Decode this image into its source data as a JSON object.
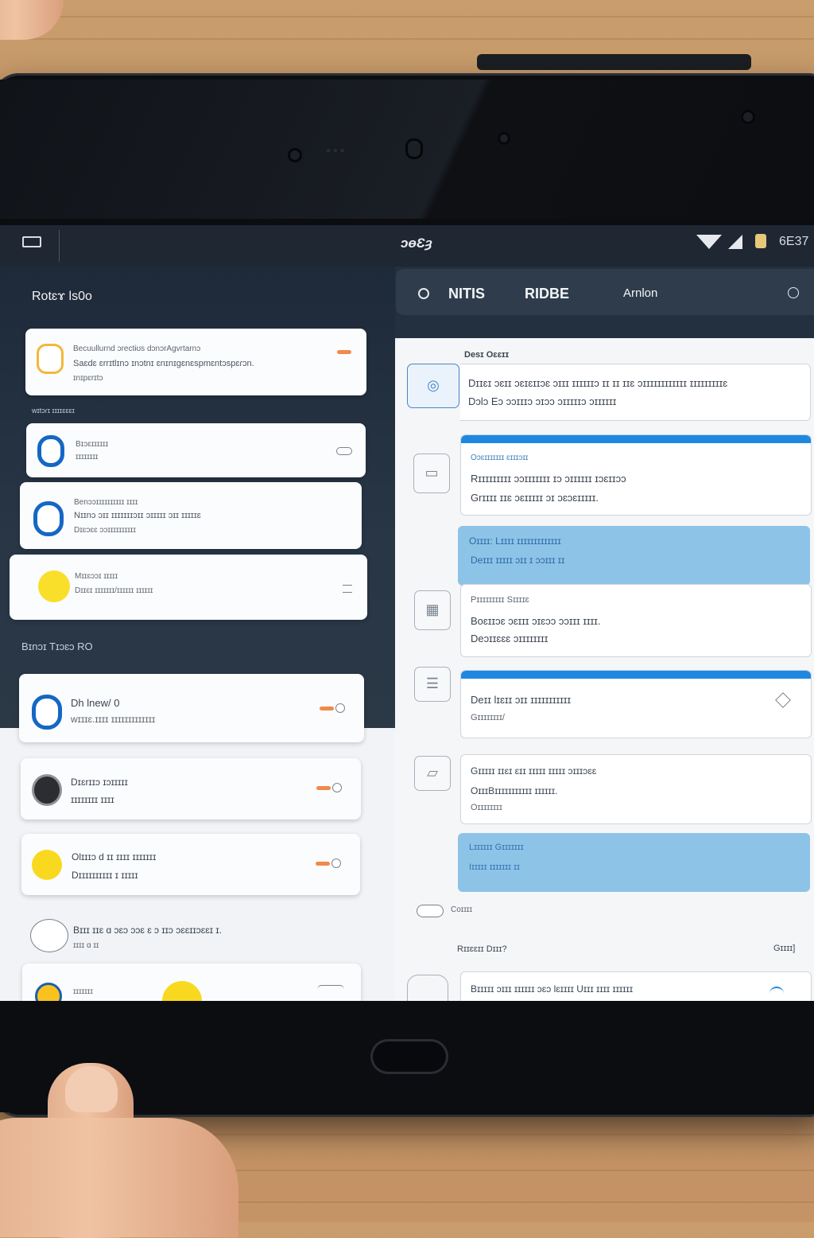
{
  "status_bar": {
    "time": "ɔɵƐȝ",
    "battery_text": "6E37"
  },
  "left_sidebar": {
    "title": "Rotɛɤ ls0o",
    "notification_top": {
      "line1": "Becuullurnd ɔrectɨʊs dɔnɔrAgvrtarnɔ",
      "line2": "Saɛdɛ ɛrrɪtlɪnɔ ɪnɔtnɪ ɛnɪnɪgɛnɛspmɛntɔspɛɾɔn.",
      "line3": "ɪnɪpɛrɪtɔ"
    },
    "section1_label": "wɪtɔɾɪ ɪɪɪɪɛɛɛɪ",
    "items_a": [
      {
        "line1": "Bɪɔɛɪɪɪɪɪɪ",
        "line2": "ɪɪɪɪɪɪɪɪ"
      },
      {
        "line1": "Benɔɔɪɪɪɪɪɪɪɪɪɪ ɪɪɪɪ",
        "line2": "Nɪɪnɔ ɔɪɪ ɪɪɪɪɪɪɪɔɪɪ ɔɪɪɪɪɪ ɔɪɪ ɪɪɪɪɪɛ",
        "line3": "Dɪɛɔɛɛ ɔɔɪɪɪɪɪɪɪɪɪɪ"
      },
      {
        "line1": "Mɪɪɛɔɔɪ ɪɪɪɪɪ",
        "line2": "Dɪɪɛɪ ɪɪɪɪɪɪɪ/ɪɪɪɪɪɪ ɪɪɪɪɪɪ"
      }
    ],
    "section2_label": "Bɪnɔɪ Tɪɔɛɔ RO",
    "items_b": [
      {
        "line1": "Dh lnew/ 0",
        "line2": "wɪɪɪɛ.ɪɪɪɪ ɪɪɪɪɪɪɪɪɪɪɪɪɪ"
      },
      {
        "line1": "Dɪɛrɪɪɔ ɪɔɪɪɪɪɪ",
        "line2": "ɪɪɪɪɪɪɪɪ ɪɪɪɪ"
      },
      {
        "line1": "Olɪɪɪɔ d ɪɪ ɪɪɪɪ ɪɪɪɪɪɪɪ",
        "line2": "Dɪɪɪɪɪɪɪɪɪɪ ɪ ɪɪɪɪɪ"
      }
    ],
    "footer_line1": "Bɪɪɪ ɪɪɛ ɑ ɔɛɔ ɔɔɛ ɛ ɔ ɪɪɔ ɔɛɛɪɪɔɛɛɪ ɪ.",
    "footer_line2": "ɪɪɪɪ ɑ ɪɪ",
    "last_item_label": "ɪɪɪɪɪɪɪ"
  },
  "tabs": {
    "tab1": "NITIS",
    "tab2": "RIDBE",
    "tab3": "Arnlon"
  },
  "detail": {
    "header": "Desɪ Oɛɛɪɪ",
    "main_line1": "Dɪɪɛɪ ɔɛɪɪ ɔɛɪɛɪɪɔɛ ɔɪɪɪ ɪɪɪɪɪɪɔ ɪɪ ɪɪ ɪɪɛ ɔɪɪɪɪɪɪɪɪɪɪɪɪ ɪɪɪɪɪɪɪɪɪɛ",
    "main_line2": "Dɔlɔ Eɔ ɔɔɪɪɪɔ ɔɪɔɔ ɔɪɪɪɪɪɔ ɔɪɪɪɪɪɪ",
    "card1": {
      "label": "Oɔɛɪɪɪɪɪɪɪ ɛɪɪɪɔɪɪ",
      "line1": "Rɪɪɪɪɪɪɪɪɪ ɔɔɪɪɪɪɪɪɪ ɪɔ ɔɪɪɪɪɪɪ ɪɔɛɪɪɔɔ",
      "line2": "Grɪɪɪɪ ɪɪɛ ɔɛɪɪɪɪɪ ɔɪ ɔɛɔɛɪɪɪɪɪ."
    },
    "blue1": {
      "line1": "Oɪɪɪɪ: Lɪɪɪɪ ɪɪɪɪɪɪɪɪɪɪɪɪɪ",
      "line2": "Deɪɪɪ ɪɪɪɪɪ ɔɪɪ ɪ ɔɔɪɪɪ ɪɪ"
    },
    "card2": {
      "label": "Pɪɪɪɪɪɪɪɪɪ Sɪɪɪɪɛ",
      "line1": "Boɛɪɪɔɛ ɔɛɪɪɪ ɔɪɛɔɔ ɔɔɪɪɪ ɪɪɪɪ.",
      "line2": "Deɔɪɪɛɛɛ ɔɪɪɪɪɪɪɪɪ"
    },
    "card3": {
      "line1": "Deɪɪ lɪɛɪɪ ɔɪɪ ɪɪɪɪɪɪɪɪɪɪɪ",
      "line2": "Gɪɪɪɪɪɪɪɪ/"
    },
    "card4": {
      "line1": "Gɪɪɪɪɪ ɪɪɛɪ ɛɪɪ ɪɪɪɪɪ ɪɪɪɪɪ ɔɪɪɪɔɛɛ",
      "line2": "OɪɪɪBɪɪɪɪɪɪɪɪɪɪɪ ɪɪɪɪɪɪ.",
      "line3": "Oɪɪɪɪɪɪɪɪ"
    },
    "blue2": {
      "line1": "Lɪɪɪɪɪɪ Gɪɪɪɪɪɪɪ",
      "line2": "Iɪɪɪɪɪ ɪɪɪɪɪɪɪ ɪɪ"
    },
    "toggle_label": "Coɪɪɪɪ",
    "bottom_left_label": "Rɪɪɛɛɪɪ Dɪɪɪ?",
    "bottom_right_label": "Gɪɪɪɪ]",
    "bottom_row": "Bɪɪɪɪɪ ɔɪɪɪ ɪɪɪɪɪɪ ɔɛɔ lɛɪɪɪɪ Uɪɪɪ ɪɪɪɪ ɪɪɪɪɪɪ"
  },
  "colors": {
    "accent_blue": "#1e88e0",
    "light_blue_card": "#8ec3e8",
    "orange_indicator": "#f08a4b",
    "yellow_avatar": "#f9d91f",
    "dark_navy": "#1f2733"
  }
}
